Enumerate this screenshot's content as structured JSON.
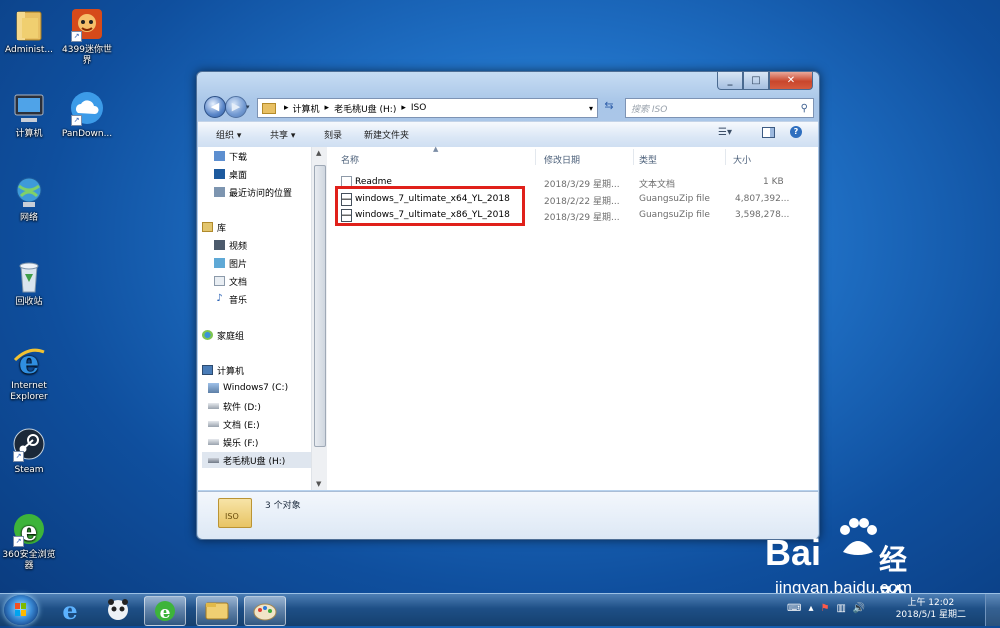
{
  "desktop": {
    "icons": [
      {
        "label": "Administ..."
      },
      {
        "label": "4399迷你世界"
      },
      {
        "label": "计算机"
      },
      {
        "label": "PanDown..."
      },
      {
        "label": "网络"
      },
      {
        "label": "回收站"
      },
      {
        "label": "Internet Explorer"
      },
      {
        "label": "Steam"
      },
      {
        "label": "360安全浏览器"
      }
    ]
  },
  "window": {
    "breadcrumb": [
      "计算机",
      "老毛桃U盘 (H:)",
      "ISO"
    ],
    "search_placeholder": "搜索 ISO",
    "toolbar": {
      "organize": "组织 ▾",
      "share": "共享 ▾",
      "burn": "刻录",
      "new_folder": "新建文件夹"
    },
    "nav": {
      "favorites": [
        "下载",
        "桌面",
        "最近访问的位置"
      ],
      "library_title": "库",
      "libraries": [
        "视频",
        "图片",
        "文档",
        "音乐"
      ],
      "homegroup": "家庭组",
      "computer_title": "计算机",
      "drives": [
        "Windows7 (C:)",
        "软件 (D:)",
        "文档 (E:)",
        "娱乐 (F:)",
        "老毛桃U盘 (H:)"
      ]
    },
    "columns": {
      "name": "名称",
      "date": "修改日期",
      "type": "类型",
      "size": "大小"
    },
    "files": [
      {
        "name": "Readme",
        "date": "2018/3/29 星期...",
        "type": "文本文档",
        "size": "1 KB"
      },
      {
        "name": "windows_7_ultimate_x64_YL_2018",
        "date": "2018/2/22 星期...",
        "type": "GuangsuZip file",
        "size": "4,807,392..."
      },
      {
        "name": "windows_7_ultimate_x86_YL_2018",
        "date": "2018/3/29 星期...",
        "type": "GuangsuZip file",
        "size": "3,598,278..."
      }
    ],
    "status": {
      "count": "3 个对象",
      "folder_icon_label": "ISO"
    }
  },
  "taskbar": {
    "time": "上午 12:02",
    "date": "2018/5/1 星期二"
  },
  "watermark": {
    "brand": "Bai",
    "brand_cn": "经验",
    "url": "jingyan.baidu.com"
  },
  "colors": {
    "highlight_box": "#e0201a",
    "taskbar": "#1e4f86",
    "desktop": "#1f6fc4"
  }
}
